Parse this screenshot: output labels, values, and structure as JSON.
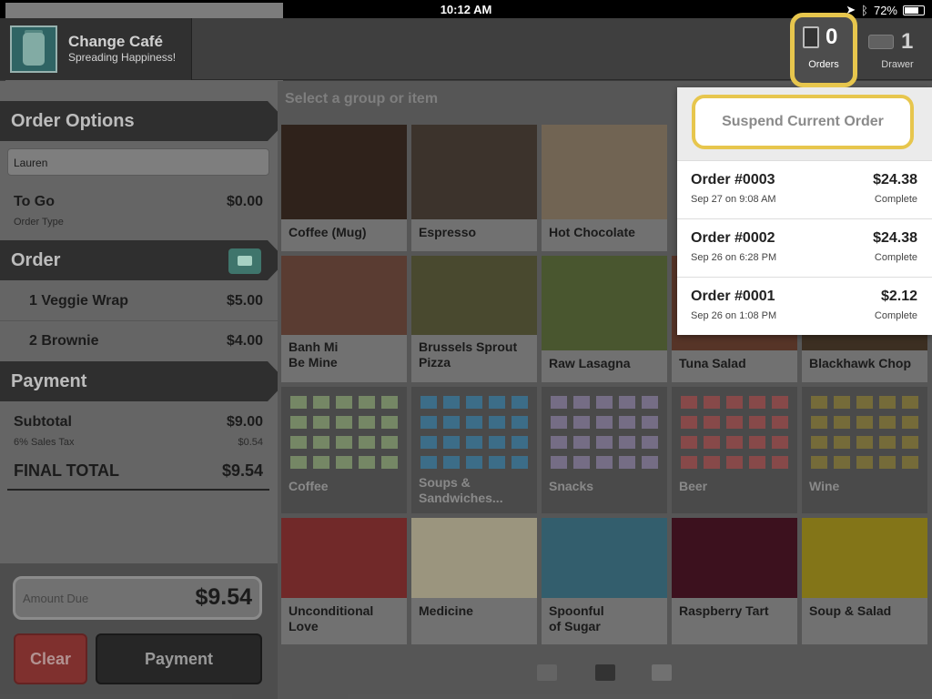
{
  "statusbar": {
    "device": "iPad",
    "time": "10:12 AM",
    "battery": "72%"
  },
  "brand": {
    "name": "Change Café",
    "tagline": "Spreading Happiness!"
  },
  "header": {
    "orders": {
      "count": "0",
      "label": "Orders"
    },
    "drawer": {
      "count": "1",
      "label": "Drawer"
    }
  },
  "left": {
    "order_options_title": "Order Options",
    "customer_name": "Lauren",
    "order_type": {
      "title": "To Go",
      "amount": "$0.00",
      "sub": "Order Type"
    },
    "order_title": "Order",
    "items": [
      {
        "label": "1 Veggie Wrap",
        "amount": "$5.00"
      },
      {
        "label": "2 Brownie",
        "amount": "$4.00"
      }
    ],
    "payment_title": "Payment",
    "subtotal": {
      "label": "Subtotal",
      "amount": "$9.00"
    },
    "tax": {
      "label": "6% Sales Tax",
      "amount": "$0.54"
    },
    "final": {
      "label": "FINAL TOTAL",
      "amount": "$9.54"
    },
    "amount_due": {
      "label": "Amount Due",
      "value": "$9.54"
    },
    "clear_label": "Clear",
    "payment_label": "Payment"
  },
  "main": {
    "search_placeholder": "Select a group or item",
    "items": [
      {
        "line1": "Coffee (Mug)",
        "line2": ""
      },
      {
        "line1": "Espresso",
        "line2": ""
      },
      {
        "line1": "Hot Chocolate",
        "line2": ""
      },
      {
        "line1": "Banh Mi",
        "line2": "Be Mine"
      },
      {
        "line1": "Brussels Sprout",
        "line2": "Pizza"
      },
      {
        "line1": "Raw Lasagna",
        "line2": ""
      },
      {
        "line1": "Tuna Salad",
        "line2": ""
      },
      {
        "line1": "Blackhawk Chop",
        "line2": ""
      }
    ],
    "groups": [
      {
        "line1": "Coffee",
        "line2": "",
        "color": "#8fa57c"
      },
      {
        "line1": "Soups &",
        "line2": "Sandwiches...",
        "color": "#4a86a6"
      },
      {
        "line1": "Snacks",
        "line2": "",
        "color": "#8f86a3"
      },
      {
        "line1": "Beer",
        "line2": "",
        "color": "#a55a5a"
      },
      {
        "line1": "Wine",
        "line2": "",
        "color": "#8f8346"
      }
    ],
    "colors": [
      {
        "line1": "Unconditional",
        "line2": "Love",
        "color": "#8a3232"
      },
      {
        "line1": "Medicine",
        "line2": "",
        "color": "#bdb69a"
      },
      {
        "line1": "Spoonful",
        "line2": "of Sugar",
        "color": "#3f7386"
      },
      {
        "line1": "Raspberry Tart",
        "line2": "",
        "color": "#4a1525"
      },
      {
        "line1": "Soup & Salad",
        "line2": "",
        "color": "#a08f1e"
      }
    ]
  },
  "dropdown": {
    "suspend_label": "Suspend Current Order",
    "orders": [
      {
        "id": "Order #0003",
        "date": "Sep 27 on 9:08 AM",
        "amount": "$24.38",
        "status": "Complete"
      },
      {
        "id": "Order #0002",
        "date": "Sep 26 on 6:28 PM",
        "amount": "$24.38",
        "status": "Complete"
      },
      {
        "id": "Order #0001",
        "date": "Sep 26 on 1:08 PM",
        "amount": "$2.12",
        "status": "Complete"
      }
    ]
  }
}
